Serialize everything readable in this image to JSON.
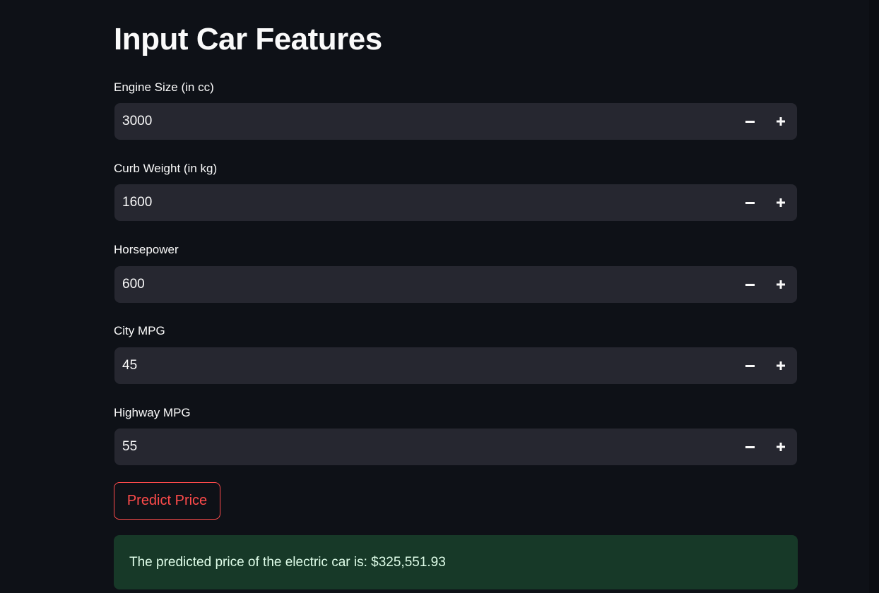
{
  "page": {
    "title": "Input Car Features"
  },
  "fields": [
    {
      "label": "Engine Size (in cc)",
      "value": "3000"
    },
    {
      "label": "Curb Weight (in kg)",
      "value": "1600"
    },
    {
      "label": "Horsepower",
      "value": "600"
    },
    {
      "label": "City MPG",
      "value": "45"
    },
    {
      "label": "Highway MPG",
      "value": "55"
    }
  ],
  "stepper": {
    "minus_icon": "minus-icon",
    "plus_icon": "plus-icon"
  },
  "actions": {
    "predict_label": "Predict Price"
  },
  "result": {
    "message": "The predicted price of the electric car is: $325,551.93"
  },
  "colors": {
    "background": "#0e1117",
    "input_bg": "#262730",
    "accent": "#ff4b4b",
    "success_bg": "#173928",
    "success_text": "#dffde9"
  }
}
